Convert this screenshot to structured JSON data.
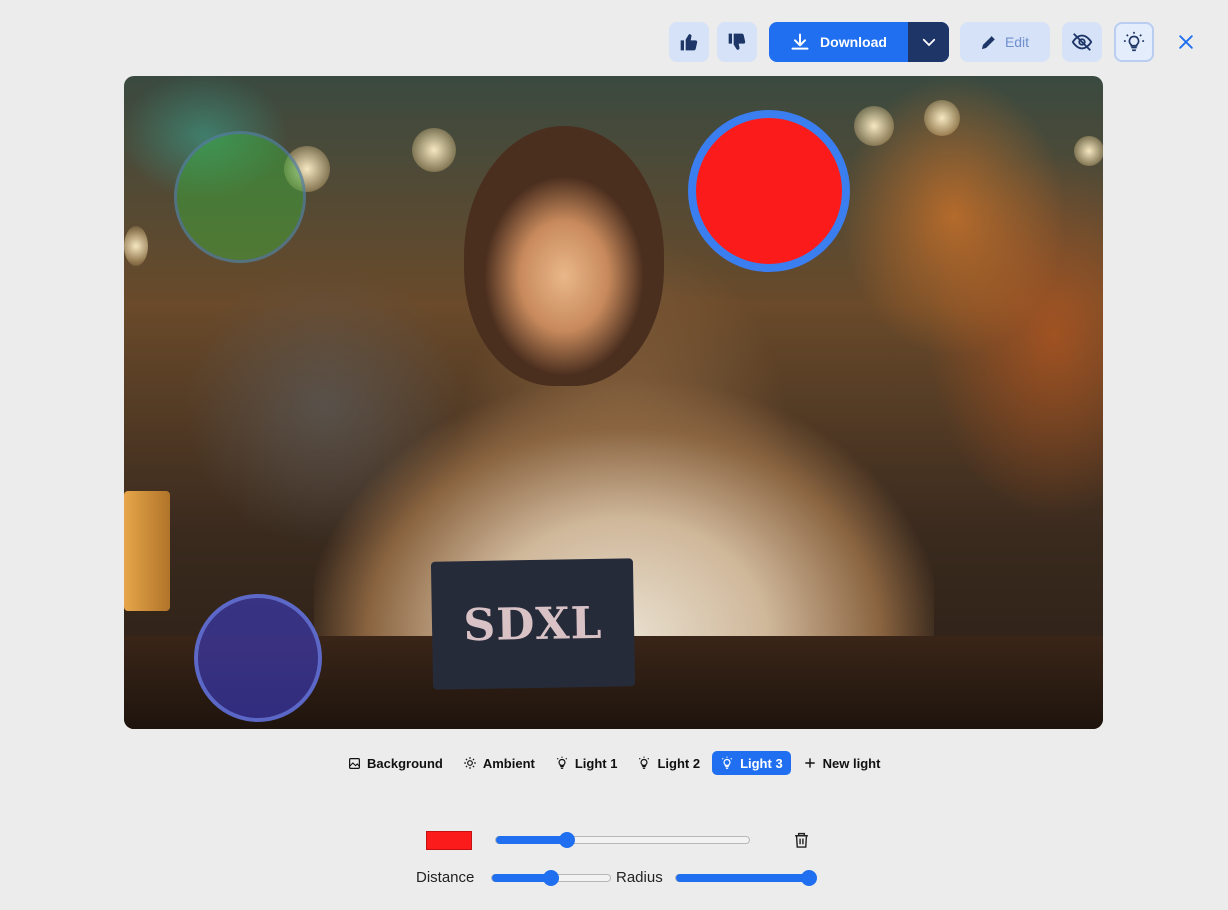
{
  "toolbar": {
    "like_icon": "thumbs-up-icon",
    "dislike_icon": "thumbs-down-icon",
    "download_label": "Download",
    "edit_label": "Edit",
    "hide_icon": "eye-off-icon",
    "light_icon": "lightbulb-icon",
    "close_icon": "close-icon"
  },
  "image": {
    "sign_text": "SDXL"
  },
  "tabs": [
    {
      "label": "Background",
      "icon": "image-icon",
      "active": false
    },
    {
      "label": "Ambient",
      "icon": "sun-icon",
      "active": false
    },
    {
      "label": "Light 1",
      "icon": "lightbulb-icon",
      "active": false
    },
    {
      "label": "Light 2",
      "icon": "lightbulb-icon",
      "active": false
    },
    {
      "label": "Light 3",
      "icon": "lightbulb-icon",
      "active": true
    },
    {
      "label": "New light",
      "icon": "plus-icon",
      "active": false
    }
  ],
  "controls": {
    "color": "#fb1b1b",
    "intensity": 0.28,
    "distance_label": "Distance",
    "distance": 0.5,
    "radius_label": "Radius",
    "radius": 1.0
  },
  "colors": {
    "accent": "#1f6ff0",
    "accent_dark": "#1e3567",
    "button_bg": "#d6e2f7",
    "light3": "#fb1b1b"
  }
}
